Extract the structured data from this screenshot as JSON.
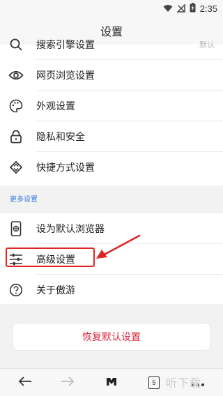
{
  "status_bar": {
    "time": "2:35"
  },
  "header": {
    "title": "设置"
  },
  "settings": {
    "items": [
      {
        "label": "搜索引擎设置",
        "value": "默认"
      },
      {
        "label": "网页浏览设置"
      },
      {
        "label": "外观设置"
      },
      {
        "label": "隐私和安全"
      },
      {
        "label": "快捷方式设置"
      }
    ]
  },
  "more_settings": {
    "section_label": "更多设置",
    "items": [
      {
        "label": "设为默认浏览器"
      },
      {
        "label": "高级设置"
      },
      {
        "label": "关于傲游"
      }
    ]
  },
  "reset_button": {
    "label": "恢复默认设置"
  },
  "bottom_bar": {
    "tab_count": "5"
  },
  "watermark": {
    "text": "听下载"
  },
  "colors": {
    "accent": "#3a7be0",
    "danger": "#d8283a",
    "highlight": "#e02525"
  }
}
